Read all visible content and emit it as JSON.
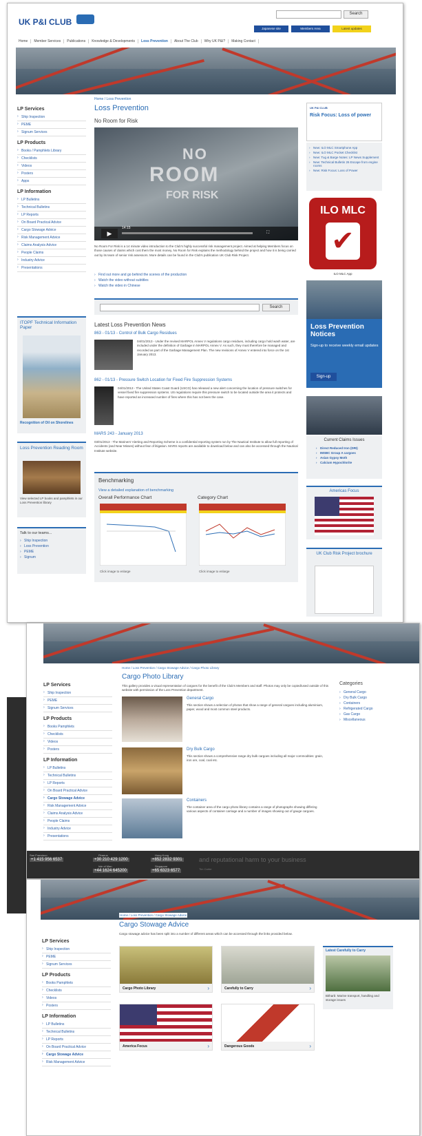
{
  "brand": {
    "logo": "UK P&I CLUB"
  },
  "header": {
    "search_btn": "Search",
    "japanese": "Japanese site",
    "members": "Members Area",
    "updates": "Latest updates"
  },
  "nav": [
    "Home",
    "Member Services",
    "Publications",
    "Knowledge & Developments",
    "Loss Prevention",
    "About The Club",
    "Why UK P&I?",
    "Making Contact"
  ],
  "page1": {
    "breadcrumb": "Home / Loss Prevention",
    "title": "Loss Prevention",
    "subtitle": "No Room for Risk",
    "video": {
      "overlay1": "NO",
      "overlay2": "ROOM",
      "overlay3": "FOR RISK",
      "time": "14:15"
    },
    "intro": "No Room For Risk is a 14 minute video introduction to the Club's highly successful risk management project. Aimed at helping Members focus on those causes of claims which cost them the most money, No Room for Risk explains the methodology behind the project and how it is being carried out by its team of senior risk assessors. More details can be found in the Club's publication UK Club Risk Project.",
    "links": [
      "Find out more and go behind the scenes of the production",
      "Watch the video without subtitles",
      "Watch the video in Chinese"
    ],
    "search_btn": "Search",
    "news_title": "Latest Loss Prevention News",
    "news": [
      {
        "title": "863 - 01/13 - Control of Bulk Cargo Residues",
        "text": "04/01/2013 - Under the revised MARPOL Annex V regulations cargo residues, including cargo hold wash water, are included under the definition of Garbage in MARPOL Annex V. As such, they must therefore be managed and recorded as part of the Garbage Management Plan. The new revisions of Annex V entered into force on the 1st January 2013."
      },
      {
        "title": "862 - 01/13 - Pressure Switch Location for Fixed Fire Suppression Systems",
        "text": "04/01/2013 - The United States Coast Guard (USCG) has released a new alert concerning the location of pressure switches for vessel fixed fire suppression systems. US regulations require this pressure switch to be located outside the area it protects and have reported an increased number of fires where this has not been the case."
      },
      {
        "title": "MARS 243 - January 2013",
        "text": "03/01/2013 - The Mariners' Alerting and Reporting Scheme is a confidential reporting system run by The Nautical Institute to allow full reporting of Accidents (and Near Misses) without fear of litigation. MARS reports are available to download below and can also be accessed through the Nautical Institute website."
      }
    ],
    "benchmark": {
      "title": "Benchmarking",
      "link": "View a detailed explanation of benchmarking",
      "chart1": "Overall Performance Chart",
      "chart2": "Category Chart",
      "caption": "Click image to enlarge"
    }
  },
  "sidebar": {
    "services_h": "LP Services",
    "services": [
      "Ship Inspection",
      "PEME",
      "Signum Services"
    ],
    "products_h": "LP Products",
    "products": [
      "Books / Pamphlets Library",
      "Checklists",
      "Videos",
      "Posters",
      "Apps"
    ],
    "info_h": "LP Information",
    "info": [
      "LP Bulletins",
      "Technical Bulletins",
      "LP Reports",
      "On Board Practical Advice",
      "Cargo Stowage Advice",
      "Risk Management Advice",
      "Claims Analysis Advice",
      "People Claims",
      "Industry Advice",
      "Presentations"
    ],
    "itopf_title": "ITOPF Technical Information Paper",
    "itopf_link": "Recognition of Oil on Shorelines",
    "reading_title": "Loss Prevention Reading Room",
    "reading_text": "View selected LP books and pamphlets in our Loss Prevention library",
    "talk_title": "Talk to our teams...",
    "talk": [
      "Ship Inspection",
      "Loss Prevention",
      "PEME",
      "Signum"
    ]
  },
  "right": {
    "risk_focus": "Risk Focus: Loss of power",
    "news": [
      "New: ILO MLC Smartphone App",
      "New: ILO MLC Pocket Checklist",
      "New: Tug & Barge Notes: LP News Supplement",
      "New: Technical Bulletin 26 Escape from engine rooms",
      "New: Risk Focus: Loss of Power"
    ],
    "ilo": "ILO MLC",
    "ilo_caption": "ILO MLC App",
    "lpn_title": "Loss Prevention Notices",
    "lpn_text": "Sign-up to receive weekly email updates",
    "signup": "Sign-up",
    "claims_title": "Current Claims Issues",
    "claims": [
      "Direct Reduced Iron (DRI)",
      "IMSBC Group A cargoes",
      "Asian Gypsy Moth",
      "Calcium Hypochlorite"
    ],
    "americas": "Americas Focus",
    "brochure": "UK Club Risk Project brochure"
  },
  "page2": {
    "breadcrumb": "Home / Loss Prevention / Cargo Stowage Advice / Cargo Photo Library",
    "title": "Cargo Photo Library",
    "intro": "This gallery provides a visual representation of cargoes for the benefit of the Club's Members and staff. Photos may only be copied/used outside of this website with permission of the Loss Prevention department.",
    "cats_title": "Categories",
    "cats": [
      "General Cargo",
      "Dry Bulk Cargo",
      "Containers",
      "Refrigerated Cargo",
      "Gas Cargo",
      "Miscellaneous"
    ],
    "sidebar": [
      "Ship Inspection",
      "PEME",
      "Signum Services",
      "Books Pamphlets",
      "Checklists",
      "Videos",
      "Posters",
      "LP Bulletins",
      "Technical Bulletins",
      "LP Reports",
      "On Board Practical Advice",
      "Cargo Stowage Advice",
      "Risk Management Advice",
      "Claims Analysis Advice",
      "People Claims",
      "Industry Advice",
      "Presentations"
    ],
    "items": [
      {
        "title": "General Cargo",
        "text": "This section shows a selection of photos that show a range of general cargoes including aluminium, paper, wood and most common steel products."
      },
      {
        "title": "Dry Bulk Cargo",
        "text": "This section shows a comprehensive range dry bulk cargoes including all major commodities: grain, iron ore, coal, coal etc."
      },
      {
        "title": "Containers",
        "text": "The container area of the cargo photo library contains a range of photographs showing differing various aspects of container carriage and a number of images showing out of gauge cargoes."
      }
    ],
    "footer": {
      "c1": "San Francisco",
      "p1": "+1 415 956 6537",
      "c2": "Piraeus",
      "p2": "+30 210 429 1200",
      "c3": "Hong Kong",
      "p3": "+852 2832 9301",
      "c4": "Isle of Man",
      "p4": "+44 1624 645200",
      "c5": "Singapore",
      "p5": "+65 6323 6577",
      "quote": "and reputational harm to your business",
      "quote_by": "Tim Carter"
    }
  },
  "page3": {
    "breadcrumb": "Home / Loss Prevention / Cargo Stowage Advice",
    "title": "Cargo Stowage Advice",
    "intro": "Cargo stowage advice has been split into a number of different areas which can be accessed through the links provided below.",
    "tiles": [
      "Cargo Photo Library",
      "Carefully to Carry",
      "America Focus",
      "Dangerous Goods"
    ],
    "side_title": "Latest Carefully to Carry",
    "side_text": "Bitharb: Marine transport, handling and storage issues",
    "sidebar": [
      "Ship Inspection",
      "PEME",
      "Signum Services",
      "Books Pamphlets",
      "Checklists",
      "Videos",
      "Posters",
      "LP Bulletins",
      "Technical Bulletins",
      "LP Reports",
      "On Board Practical Advice",
      "Cargo Stowage Advice",
      "Risk Management Advice"
    ]
  }
}
